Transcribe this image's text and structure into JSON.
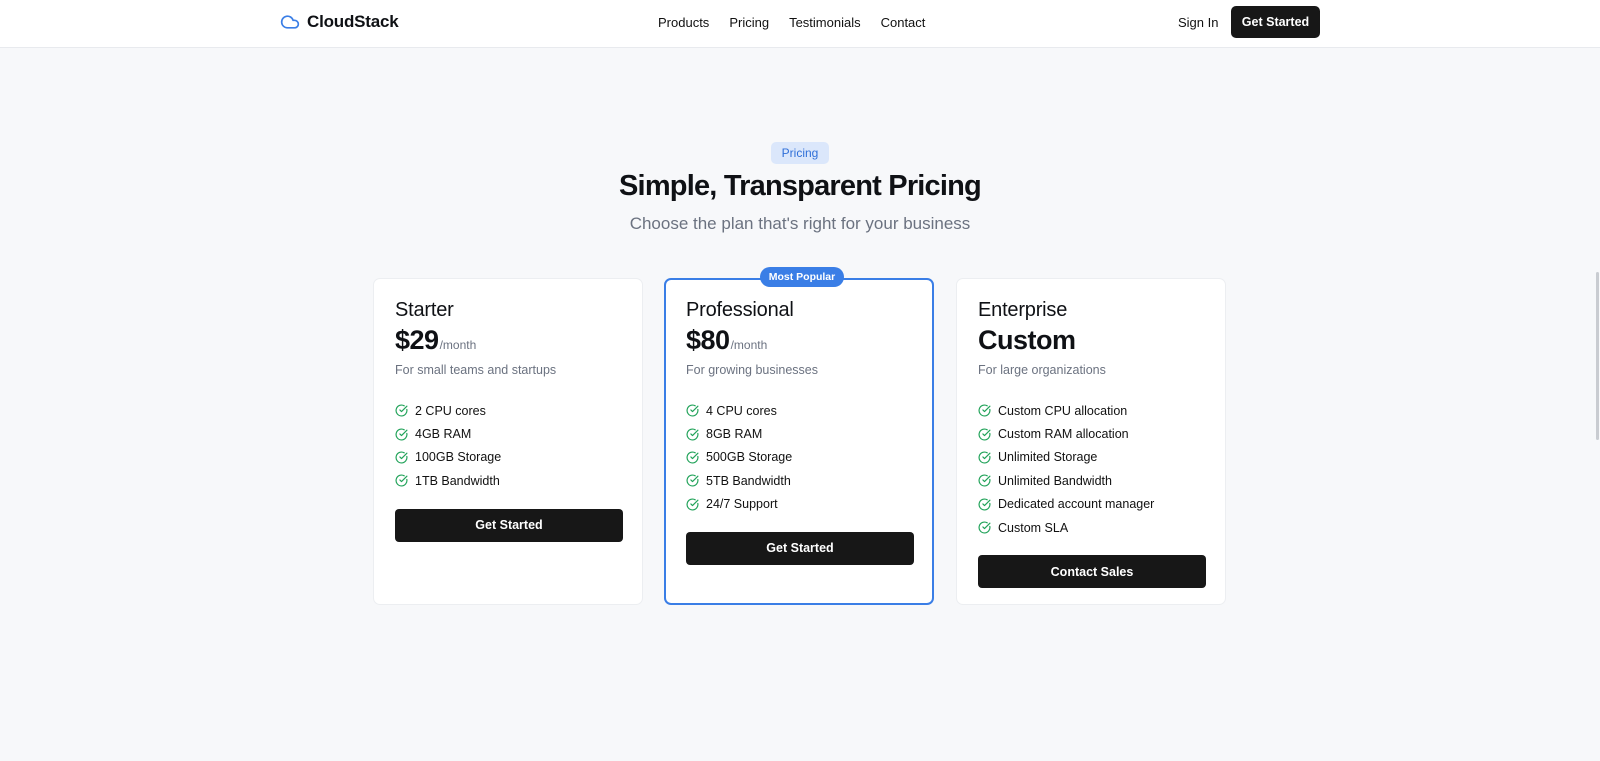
{
  "brand": {
    "name": "CloudStack",
    "logo_icon": "cloud-icon",
    "accent": "#3a7ee6"
  },
  "nav": {
    "links": [
      "Products",
      "Pricing",
      "Testimonials",
      "Contact"
    ],
    "sign_in": "Sign In",
    "cta": "Get Started"
  },
  "hero": {
    "badge": "Pricing",
    "title": "Simple, Transparent Pricing",
    "subtitle": "Choose the plan that's right for your business"
  },
  "plans": [
    {
      "name": "Starter",
      "price": "$29",
      "period": "/month",
      "description": "For small teams and startups",
      "features": [
        "2 CPU cores",
        "4GB RAM",
        "100GB Storage",
        "1TB Bandwidth"
      ],
      "cta": "Get Started"
    },
    {
      "name": "Professional",
      "badge": "Most Popular",
      "price": "$80",
      "period": "/month",
      "description": "For growing businesses",
      "features": [
        "4 CPU cores",
        "8GB RAM",
        "500GB Storage",
        "5TB Bandwidth",
        "24/7 Support"
      ],
      "cta": "Get Started"
    },
    {
      "name": "Enterprise",
      "price": "Custom",
      "period": "",
      "description": "For large organizations",
      "features": [
        "Custom CPU allocation",
        "Custom RAM allocation",
        "Unlimited Storage",
        "Unlimited Bandwidth",
        "Dedicated account manager",
        "Custom SLA"
      ],
      "cta": "Contact Sales"
    }
  ],
  "colors": {
    "check": "#22a35a",
    "button": "#171717",
    "badge_bg": "#dbe7fb"
  }
}
